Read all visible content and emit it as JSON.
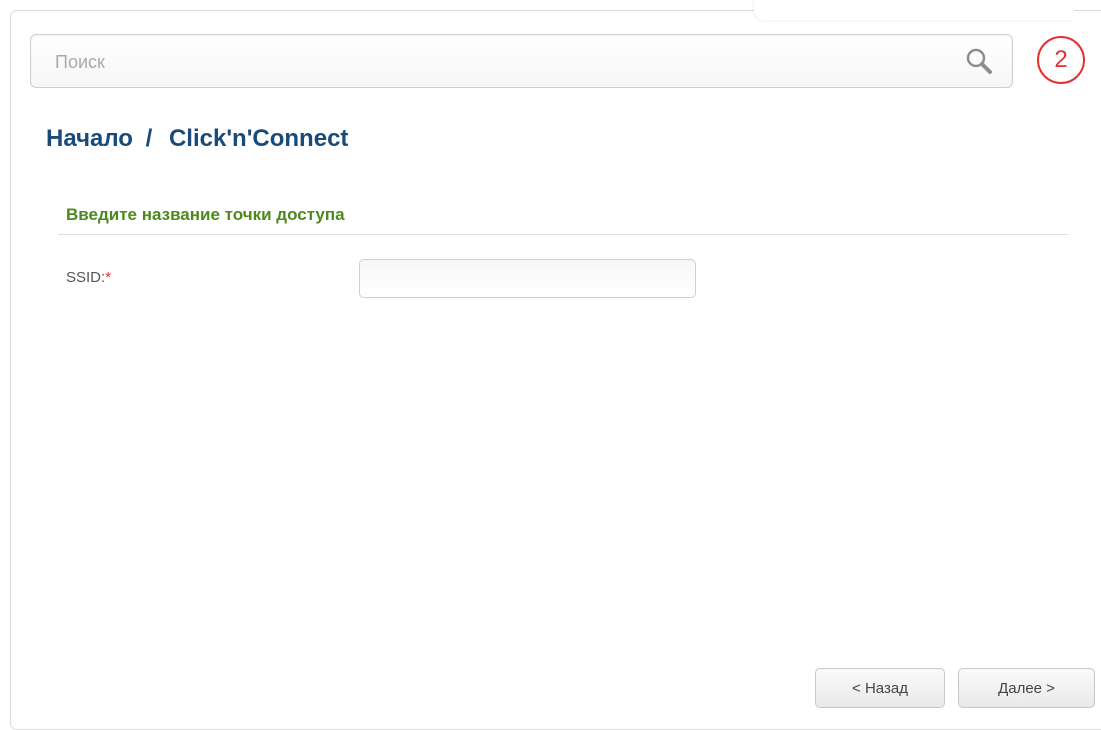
{
  "search": {
    "placeholder": "Поиск",
    "icon": "search-icon"
  },
  "step_indicator": {
    "number": "2",
    "color": "#e53030"
  },
  "breadcrumb": {
    "home": "Начало",
    "separator": "/",
    "current": "Click'n'Connect"
  },
  "section": {
    "title": "Введите название точки доступа"
  },
  "form": {
    "ssid_label": "SSID:",
    "required_mark": "*",
    "ssid_value": ""
  },
  "buttons": {
    "back_label": "< Назад",
    "next_label": "Далее >"
  },
  "colors": {
    "title_blue": "#184b7a",
    "section_green": "#4d8a1e",
    "required_red": "#e53030"
  }
}
